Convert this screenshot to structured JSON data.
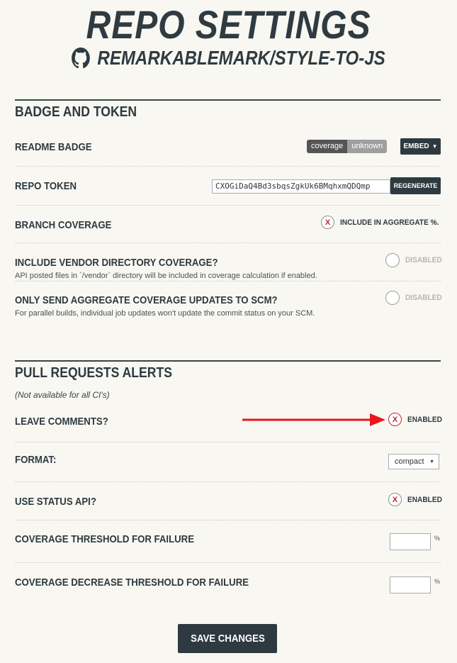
{
  "header": {
    "title": "REPO SETTINGS",
    "repo": "REMARKABLEMARK/STYLE-TO-JS"
  },
  "badge_section": {
    "title": "BADGE AND TOKEN",
    "readme_badge": {
      "label": "README BADGE",
      "badge_left": "coverage",
      "badge_right": "unknown",
      "embed_label": "EMBED"
    },
    "repo_token": {
      "label": "REPO TOKEN",
      "value": "CXOGiDaQ4Bd3sbqsZgkUk6BMqhxmQDQmp",
      "regenerate_label": "REGENERATE"
    },
    "branch_coverage": {
      "label": "BRANCH COVERAGE",
      "toggle_mark": "X",
      "toggle_label": "INCLUDE IN AGGREGATE %."
    },
    "vendor": {
      "label": "INCLUDE VENDOR DIRECTORY COVERAGE?",
      "desc": "API posted files in `/vendor` directory will be included in coverage calculation if enabled.",
      "toggle_label": "DISABLED"
    },
    "aggregate_only": {
      "label": "ONLY SEND AGGREGATE COVERAGE UPDATES TO SCM?",
      "desc": "For parallel builds, individual job updates won't update the commit status on your SCM.",
      "toggle_label": "DISABLED"
    }
  },
  "pr_section": {
    "title": "PULL REQUESTS ALERTS",
    "note": "(Not available for all CI's)",
    "leave_comments": {
      "label": "LEAVE COMMENTS?",
      "toggle_mark": "X",
      "toggle_label": "ENABLED"
    },
    "format": {
      "label": "FORMAT:",
      "selected": "compact"
    },
    "status_api": {
      "label": "USE STATUS API?",
      "toggle_mark": "X",
      "toggle_label": "ENABLED"
    },
    "threshold": {
      "label": "COVERAGE THRESHOLD FOR FAILURE",
      "unit": "%",
      "value": ""
    },
    "decrease_threshold": {
      "label": "COVERAGE DECREASE THRESHOLD FOR FAILURE",
      "unit": "%",
      "value": ""
    }
  },
  "save_label": "SAVE CHANGES",
  "colors": {
    "background": "#f8f7f2",
    "dark": "#2e3a40",
    "accent_red": "#e8151b",
    "toggle_red": "#c0282d"
  }
}
